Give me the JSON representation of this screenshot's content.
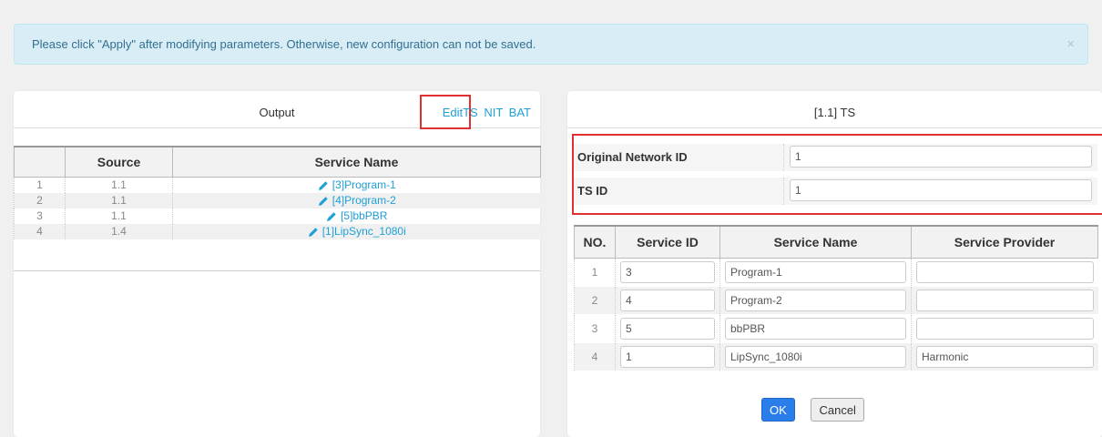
{
  "alert": {
    "message": "Please click \"Apply\" after modifying parameters. Otherwise, new configuration can not be saved.",
    "close": "×"
  },
  "left": {
    "title": "Output",
    "links": {
      "edit_ts": "EditTS",
      "nit": "NIT",
      "bat": "BAT"
    },
    "columns": [
      "",
      "Source",
      "Service Name"
    ],
    "rows": [
      {
        "no": "1",
        "source": "1.1",
        "name": "[3]Program-1"
      },
      {
        "no": "2",
        "source": "1.1",
        "name": "[4]Program-2"
      },
      {
        "no": "3",
        "source": "1.1",
        "name": "[5]bbPBR"
      },
      {
        "no": "4",
        "source": "1.4",
        "name": "[1]LipSync_1080i"
      }
    ]
  },
  "right": {
    "title": "[1.1] TS",
    "fields": {
      "onid_label": "Original Network ID",
      "onid_value": "1",
      "tsid_label": "TS ID",
      "tsid_value": "1"
    },
    "columns": [
      "NO.",
      "Service ID",
      "Service Name",
      "Service Provider"
    ],
    "rows": [
      {
        "no": "1",
        "id": "3",
        "name": "Program-1",
        "provider": ""
      },
      {
        "no": "2",
        "id": "4",
        "name": "Program-2",
        "provider": ""
      },
      {
        "no": "3",
        "id": "5",
        "name": "bbPBR",
        "provider": ""
      },
      {
        "no": "4",
        "id": "1",
        "name": "LipSync_1080i",
        "provider": "Harmonic"
      }
    ],
    "ok_label": "OK",
    "cancel_label": "Cancel"
  },
  "colors": {
    "accent": "#1e9fd6",
    "highlight": "#e03030",
    "primary_button": "#2b7de9"
  },
  "icons": {
    "edit": "pencil-icon",
    "close": "close-icon"
  }
}
